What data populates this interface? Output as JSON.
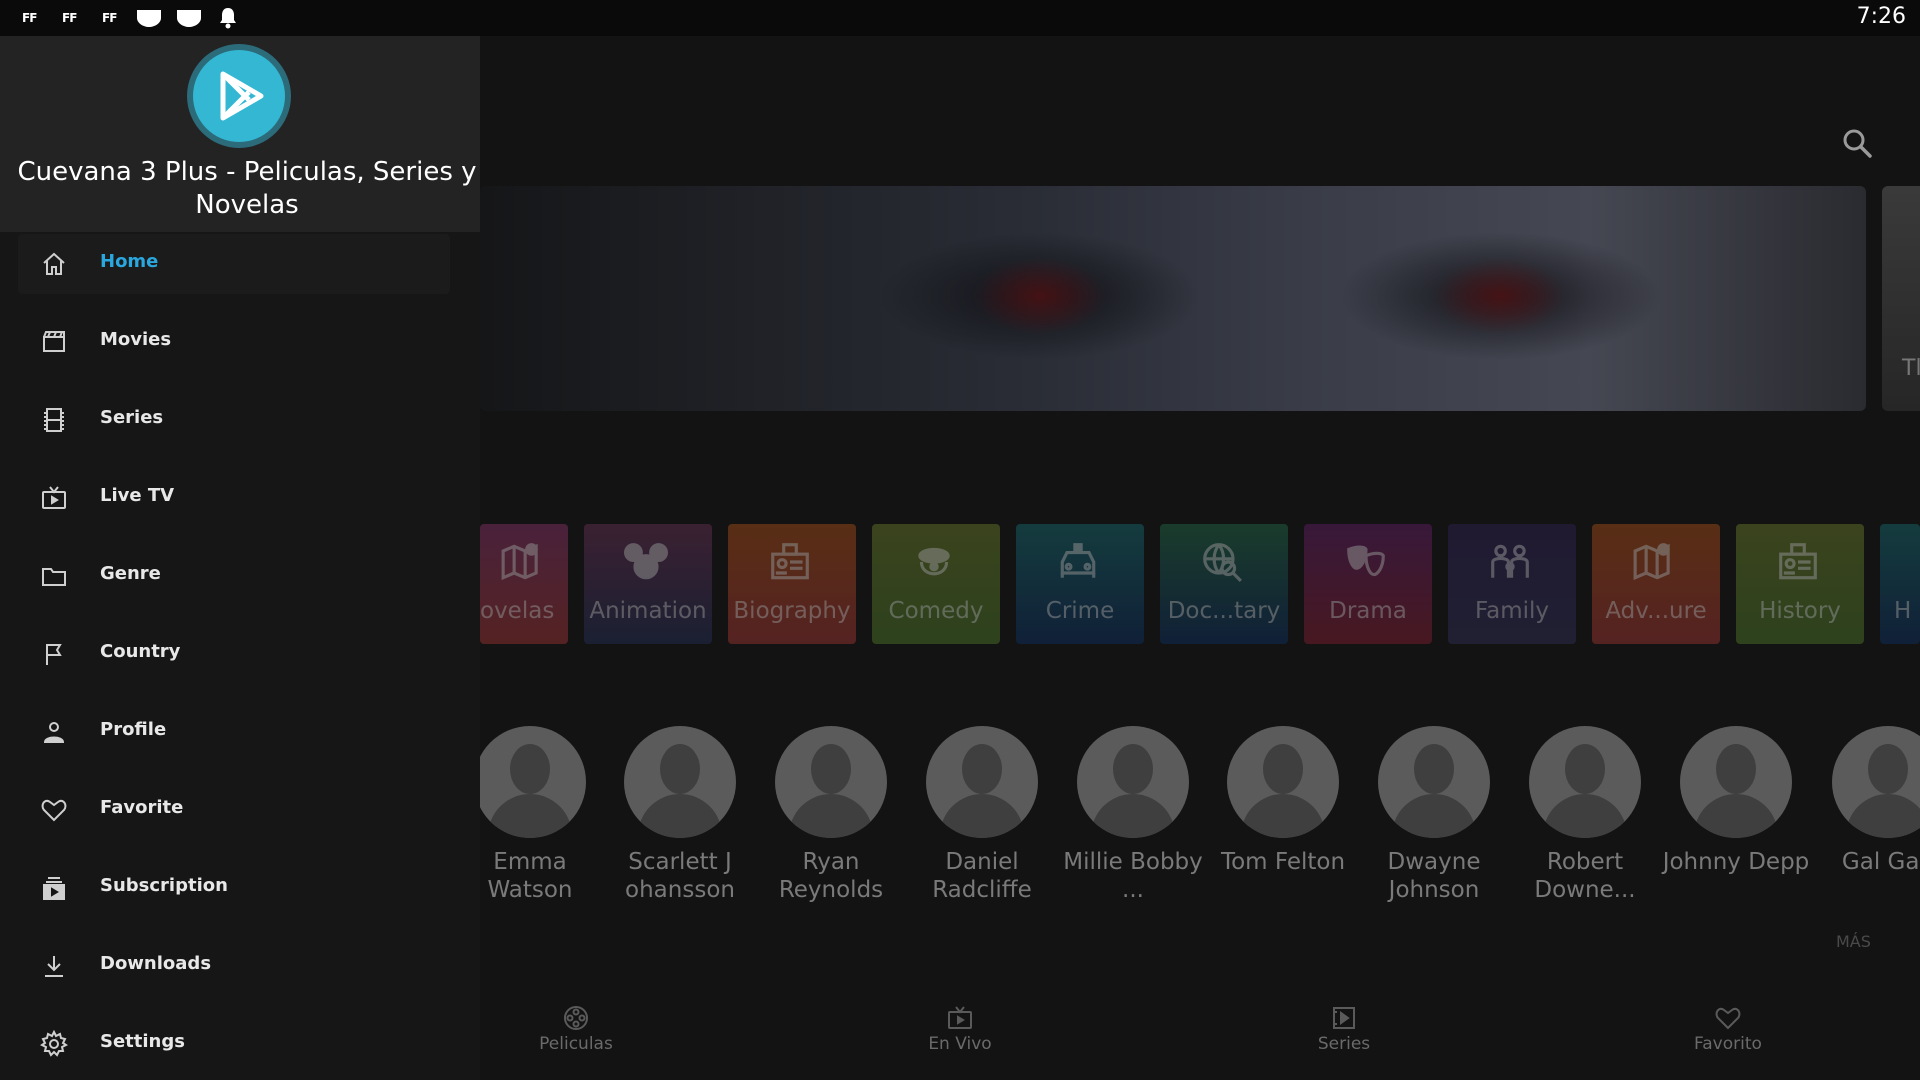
{
  "status_bar": {
    "icons": [
      "ff-icon",
      "ff-icon",
      "ff-icon",
      "shield-icon",
      "shield-icon",
      "bell-icon"
    ],
    "ff_text": "FF",
    "time": "7:26"
  },
  "drawer": {
    "app_title": "Cuevana 3 Plus - Peliculas, Series y Novelas",
    "items": [
      {
        "label": "Home",
        "icon": "home-icon",
        "active": true
      },
      {
        "label": "Movies",
        "icon": "clapperboard-icon"
      },
      {
        "label": "Series",
        "icon": "film-strip-icon"
      },
      {
        "label": "Live TV",
        "icon": "tv-icon"
      },
      {
        "label": "Genre",
        "icon": "folder-icon"
      },
      {
        "label": "Country",
        "icon": "flag-icon"
      },
      {
        "label": "Profile",
        "icon": "person-icon"
      },
      {
        "label": "Favorite",
        "icon": "heart-icon"
      },
      {
        "label": "Subscription",
        "icon": "subscription-icon"
      },
      {
        "label": "Downloads",
        "icon": "download-icon"
      },
      {
        "label": "Settings",
        "icon": "gear-icon"
      }
    ],
    "active_color": "#2aa7de"
  },
  "banner": {
    "next_peek_text": "Tl"
  },
  "genres": [
    {
      "label": "ovelas",
      "icon": "map-icon",
      "color_top": "#8a3a6e",
      "color_bottom": "#a33c3c"
    },
    {
      "label": "Animation",
      "icon": "mouse-ears-icon",
      "color_top": "#6e3a5c",
      "color_bottom": "#2e3a5e"
    },
    {
      "label": "Biography",
      "icon": "id-card-icon",
      "color_top": "#a8521e",
      "color_bottom": "#a33c3c"
    },
    {
      "label": "Comedy",
      "icon": "clown-icon",
      "color_top": "#6a7a2e",
      "color_bottom": "#4e7a2e"
    },
    {
      "label": "Crime",
      "icon": "police-car-icon",
      "color_top": "#1e6e72",
      "color_bottom": "#1a3a6a"
    },
    {
      "label": "Doc...tary",
      "icon": "globe-search-icon",
      "color_top": "#2a6e4e",
      "color_bottom": "#1a3a6a"
    },
    {
      "label": "Drama",
      "icon": "theater-masks-icon",
      "color_top": "#6a2a6e",
      "color_bottom": "#8a2a3a"
    },
    {
      "label": "Family",
      "icon": "family-icon",
      "color_top": "#3a2e5e",
      "color_bottom": "#3a3a5e"
    },
    {
      "label": "Adv...ure",
      "icon": "map-icon",
      "color_top": "#a8521e",
      "color_bottom": "#a33c3c"
    },
    {
      "label": "History",
      "icon": "id-card-icon",
      "color_top": "#6a7a2e",
      "color_bottom": "#4e7a2e"
    },
    {
      "label": "H",
      "icon": "",
      "color_top": "#1e6e72",
      "color_bottom": "#1a3a6a"
    }
  ],
  "cast": [
    {
      "name": "Emma Watson"
    },
    {
      "name": "Scarlett J ohansson"
    },
    {
      "name": "Ryan Reynolds"
    },
    {
      "name": "Daniel Radcliffe"
    },
    {
      "name": "Millie Bobby ..."
    },
    {
      "name": "Tom Felton"
    },
    {
      "name": "Dwayne Johnson"
    },
    {
      "name": "Robert Downe..."
    },
    {
      "name": "Johnny Depp"
    },
    {
      "name": "Gal Gad"
    }
  ],
  "more_label": "MÁS",
  "bottom_nav": [
    {
      "label": "Peliculas",
      "icon": "film-reel-icon"
    },
    {
      "label": "En Vivo",
      "icon": "tv-icon"
    },
    {
      "label": "Series",
      "icon": "play-square-icon"
    },
    {
      "label": "Favorito",
      "icon": "heart-icon"
    }
  ]
}
